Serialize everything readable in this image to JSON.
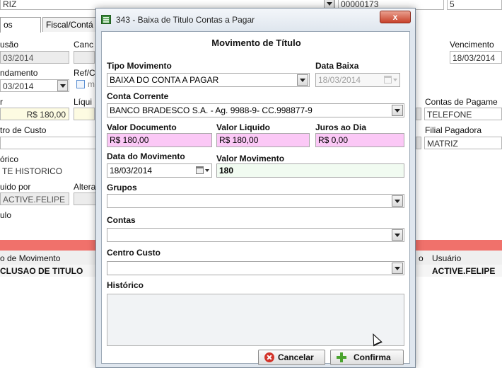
{
  "background": {
    "top": {
      "field1_value": "RIZ",
      "field2_value": "00000173",
      "field3_value": "5"
    },
    "tabs": [
      {
        "label": "os Gerais"
      },
      {
        "label": "Fiscal/Contá"
      }
    ],
    "labels": {
      "inclusao": "usão",
      "canc": "Canc",
      "vencimento": "Vencimento",
      "vendamento": "ndamento",
      "ref": "Ref/C",
      "valor": "r",
      "liquido": "Líqui",
      "contas_pagamento": "Contas de Pagame",
      "centro_custo": "tro de Custo",
      "filial_pagadora": "Filial Pagadora",
      "historico": "órico",
      "liquido_por": "uido por",
      "alterado": "Altera",
      "titulo": "ulo",
      "m_check": "m"
    },
    "values": {
      "inclusao": "03/2014",
      "vencimento": "18/03/2014",
      "vendamento": "03/2014",
      "valor": "R$ 180,00",
      "contas_pagamento": "TELEFONE",
      "filial_pagadora": "MATRIZ",
      "historico": "TE HISTORICO",
      "liquido_por": "ACTIVE.FELIPE"
    },
    "grid": {
      "headers": [
        "o de Movimento",
        "o",
        "Usuário"
      ],
      "row": [
        "CLUSAO DE TITULO",
        "ACTIVE.FELIPE"
      ]
    }
  },
  "dialog": {
    "title": "343 - Baixa de Titulo Contas a Pagar",
    "close_label": "x",
    "section_title": "Movimento de Título",
    "tipo_movimento": {
      "label": "Tipo Movimento",
      "value": "BAIXA DO CONTA A PAGAR"
    },
    "data_baixa": {
      "label": "Data Baixa",
      "value": "18/03/2014"
    },
    "conta_corrente": {
      "label": "Conta Corrente",
      "value": "BANCO BRADESCO S.A. - Ag. 9988-9- CC.998877-9"
    },
    "valor_documento": {
      "label": "Valor Documento",
      "value": "R$ 180,00"
    },
    "valor_liquido": {
      "label": "Valor Liquido",
      "value": "R$ 180,00"
    },
    "juros_dia": {
      "label": "Juros ao Dia",
      "value": "R$ 0,00"
    },
    "data_movimento": {
      "label": "Data do Movimento",
      "value": "18/03/2014"
    },
    "valor_movimento": {
      "label": "Valor Movimento",
      "value": "180"
    },
    "grupos": {
      "label": "Grupos",
      "value": ""
    },
    "contas": {
      "label": "Contas",
      "value": ""
    },
    "centro_custo": {
      "label": "Centro Custo",
      "value": ""
    },
    "historico": {
      "label": "Histórico",
      "value": ""
    },
    "buttons": {
      "cancel": "Cancelar",
      "confirm": "Confirma"
    }
  },
  "colors": {
    "pink_field": "#fbc8f6",
    "red_band": "#f0716b",
    "close_button": "#c8412a",
    "confirm_icon": "#4aa32e",
    "cancel_icon": "#d2342a"
  }
}
